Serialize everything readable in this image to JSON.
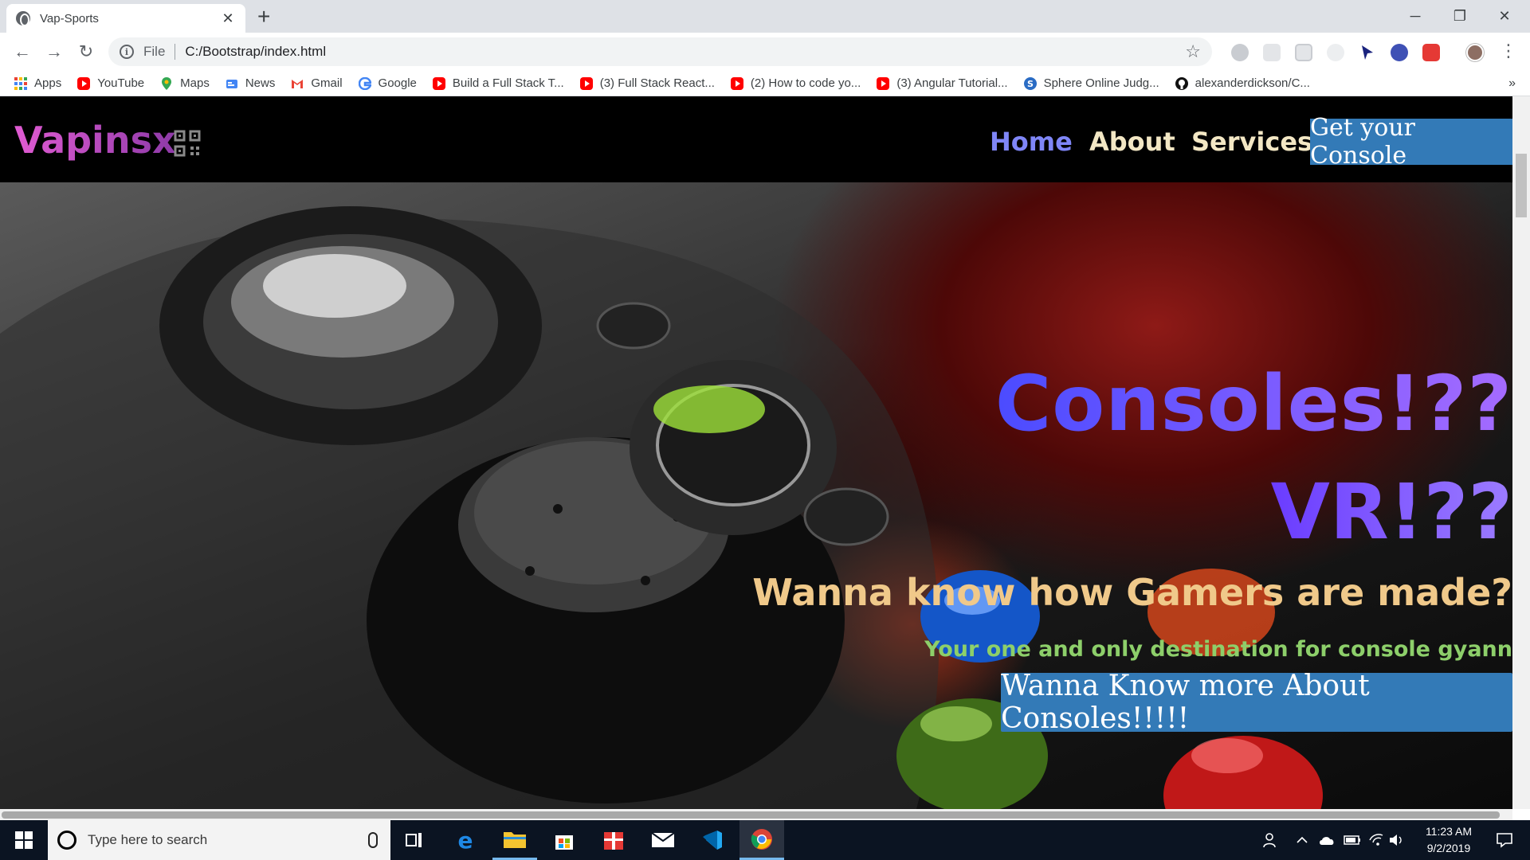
{
  "browser": {
    "tab_title": "Vap-Sports",
    "tab_close": "✕",
    "new_tab": "+",
    "window_controls": {
      "minimize": "─",
      "restore": "❐",
      "close": "✕"
    },
    "nav": {
      "back": "←",
      "forward": "→",
      "reload": "↻"
    },
    "address": {
      "scheme": "File",
      "url": "C:/Bootstrap/index.html",
      "star": "☆",
      "info_glyph": "i"
    },
    "menu": "⋮"
  },
  "bookmarks": {
    "items": [
      {
        "label": "Apps",
        "icon": "apps-grid-icon"
      },
      {
        "label": "YouTube",
        "icon": "youtube-icon"
      },
      {
        "label": "Maps",
        "icon": "maps-icon"
      },
      {
        "label": "News",
        "icon": "news-icon"
      },
      {
        "label": "Gmail",
        "icon": "gmail-icon"
      },
      {
        "label": "Google",
        "icon": "google-icon"
      },
      {
        "label": "Build a Full Stack T...",
        "icon": "youtube-icon"
      },
      {
        "label": "(3) Full Stack React...",
        "icon": "youtube-icon"
      },
      {
        "label": "(2) How to code yo...",
        "icon": "youtube-icon"
      },
      {
        "label": "(3) Angular Tutorial...",
        "icon": "youtube-icon"
      },
      {
        "label": "Sphere Online Judg...",
        "icon": "spoj-icon"
      },
      {
        "label": "alexanderdickson/C...",
        "icon": "github-icon"
      }
    ],
    "more": "»"
  },
  "site": {
    "brand": "Vapinsx",
    "nav": {
      "home": "Home",
      "about": "About",
      "services": "Services",
      "cta": "Get your Console"
    },
    "hero": {
      "headline_1": "Consoles!??",
      "headline_2": "VR!??",
      "tagline": "Wanna know how Gamers are made?",
      "subtagline": "Your one and only destination for console gyann",
      "cta": "Wanna Know more About Consoles!!!!!"
    }
  },
  "taskbar": {
    "search_placeholder": "Type here to search",
    "clock_time": "11:23 AM",
    "clock_date": "9/2/2019"
  },
  "colors": {
    "nav_active": "#7f86f7",
    "nav_link": "#f3e7c4",
    "button_blue": "#337ab7",
    "tagline": "#f0c98a",
    "subtagline": "#8dcf6a"
  }
}
